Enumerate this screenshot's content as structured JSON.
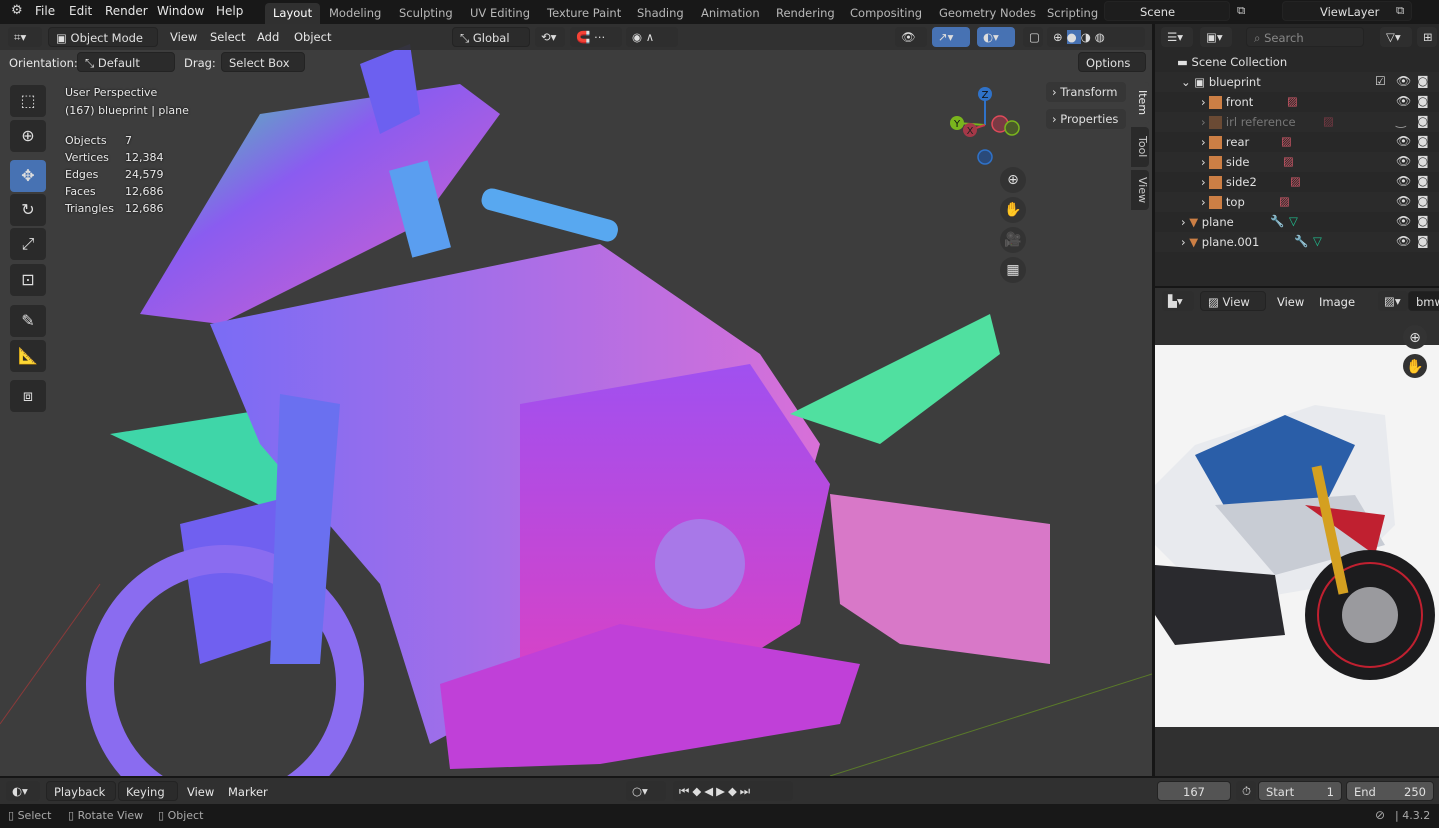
{
  "topbar": {
    "menus": [
      "File",
      "Edit",
      "Render",
      "Window",
      "Help"
    ],
    "workspaces": [
      "Layout",
      "Modeling",
      "Sculpting",
      "UV Editing",
      "Texture Paint",
      "Shading",
      "Animation",
      "Rendering",
      "Compositing",
      "Geometry Nodes",
      "Scripting"
    ],
    "active_workspace": "Layout",
    "scene": "Scene",
    "view_layer": "ViewLayer"
  },
  "viewport_header": {
    "mode": "Object Mode",
    "menus": [
      "View",
      "Select",
      "Add",
      "Object"
    ],
    "transform_orientation": "Global",
    "orientation_label": "Orientation:",
    "orientation_value": "Default",
    "drag_label": "Drag:",
    "drag_value": "Select Box",
    "options_label": "Options"
  },
  "viewport_overlay": {
    "perspective": "User Perspective",
    "context": "(167) blueprint | plane",
    "stats": [
      {
        "label": "Objects",
        "value": "7"
      },
      {
        "label": "Vertices",
        "value": "12,384"
      },
      {
        "label": "Edges",
        "value": "24,579"
      },
      {
        "label": "Faces",
        "value": "12,686"
      },
      {
        "label": "Triangles",
        "value": "12,686"
      }
    ],
    "gizmo_axes": {
      "z": "Z",
      "y": "Y",
      "x": "X"
    }
  },
  "sidebar": {
    "panels": [
      "Transform",
      "Properties"
    ],
    "tabs": [
      "Item",
      "Tool",
      "View"
    ],
    "active_tab": "Item"
  },
  "outliner": {
    "search_placeholder": "Search",
    "root": "Scene Collection",
    "items": [
      {
        "name": "blueprint",
        "type": "collection",
        "level": 1,
        "expanded": true
      },
      {
        "name": "front",
        "type": "image",
        "level": 2
      },
      {
        "name": "irl reference",
        "type": "image",
        "level": 2,
        "hidden": true
      },
      {
        "name": "rear",
        "type": "image",
        "level": 2
      },
      {
        "name": "side",
        "type": "image",
        "level": 2
      },
      {
        "name": "side2",
        "type": "image",
        "level": 2
      },
      {
        "name": "top",
        "type": "image",
        "level": 2
      },
      {
        "name": "plane",
        "type": "mesh",
        "level": 1
      },
      {
        "name": "plane.001",
        "type": "mesh",
        "level": 1
      }
    ]
  },
  "image_editor": {
    "view_dropdown": "View",
    "menus": [
      "View",
      "Image"
    ],
    "image_name": "bmw"
  },
  "timeline": {
    "menus": [
      "Playback",
      "Keying",
      "View",
      "Marker"
    ],
    "current_frame": "167",
    "start_label": "Start",
    "start": "1",
    "end_label": "End",
    "end": "250"
  },
  "statusbar": {
    "hints": [
      "Select",
      "Rotate View",
      "Object"
    ],
    "version": "4.3.2"
  },
  "colors": {
    "accent": "#4772b3",
    "x_axis": "#c9384b",
    "y_axis": "#7ab51d",
    "z_axis": "#2f72c9",
    "object_icon": "#cc7f45"
  }
}
